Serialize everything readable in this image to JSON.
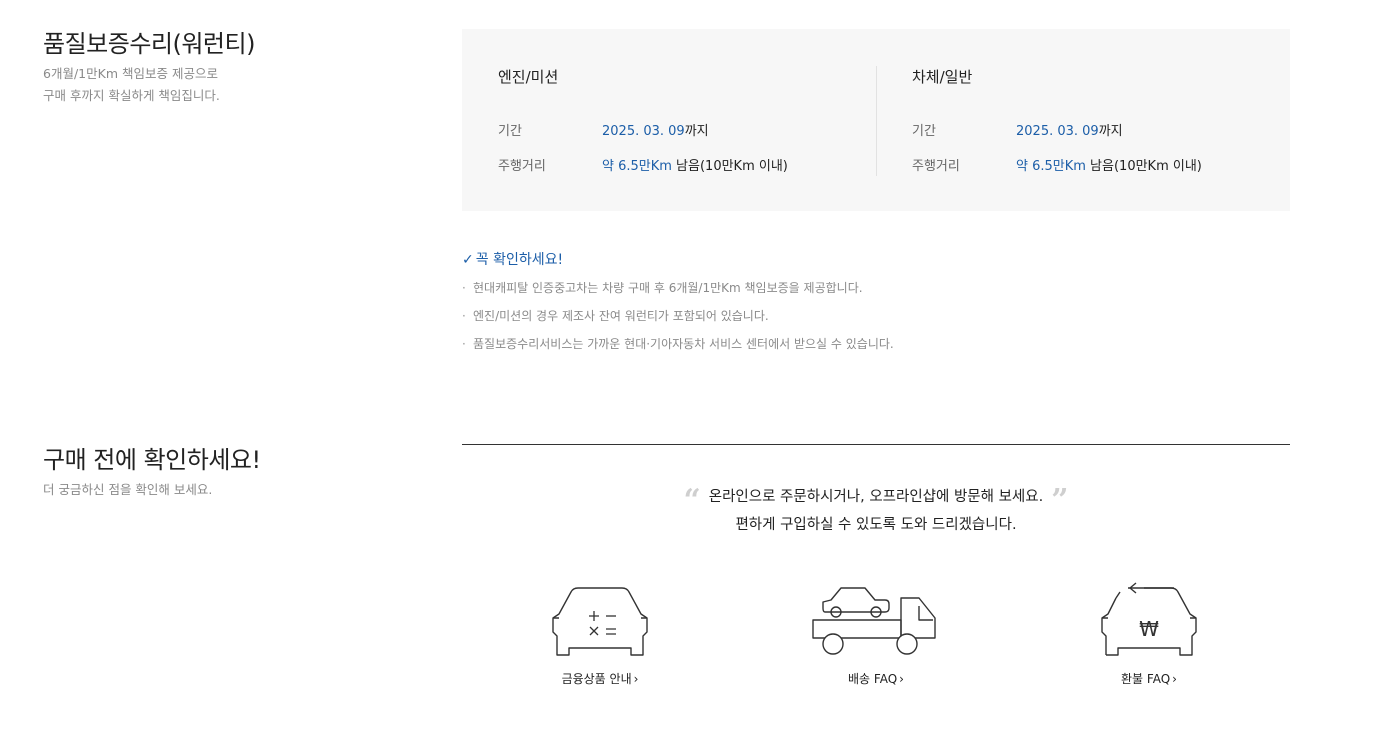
{
  "warranty": {
    "title": "품질보증수리(워런티)",
    "desc_line1": "6개월/1만Km 책임보증 제공으로",
    "desc_line2": "구매 후까지 확실하게 책임집니다.",
    "columns": [
      {
        "title": "엔진/미션",
        "period_label": "기간",
        "period_value": "2025. 03. 09",
        "period_suffix": "까지",
        "distance_label": "주행거리",
        "distance_value": "약 6.5만Km",
        "distance_suffix": " 남음(10만Km 이내)"
      },
      {
        "title": "차체/일반",
        "period_label": "기간",
        "period_value": "2025. 03. 09",
        "period_suffix": "까지",
        "distance_label": "주행거리",
        "distance_value": "약 6.5만Km",
        "distance_suffix": " 남음(10만Km 이내)"
      }
    ]
  },
  "check": {
    "title": "꼭 확인하세요!",
    "items": [
      "현대캐피탈 인증중고차는 차량 구매 후 6개월/1만Km 책임보증을 제공합니다.",
      "엔진/미션의 경우 제조사 잔여 워런티가 포함되어 있습니다.",
      "품질보증수리서비스는 가까운 현대·기아자동차 서비스 센터에서 받으실 수 있습니다."
    ]
  },
  "before_purchase": {
    "title": "구매 전에 확인하세요!",
    "desc": "더 궁금하신 점을 확인해 보세요.",
    "quote_line1": "온라인으로 주문하시거나, 오프라인샵에 방문해 보세요.",
    "quote_line2": "편하게 구입하실 수 있도록 도와 드리겠습니다.",
    "links": [
      {
        "label": "금융상품 안내",
        "icon": "car-calculator-icon"
      },
      {
        "label": "배송 FAQ",
        "icon": "tow-truck-icon"
      },
      {
        "label": "환불 FAQ",
        "icon": "car-refund-icon"
      }
    ]
  },
  "colors": {
    "accent": "#1c5ea8",
    "muted": "#8a8a8a",
    "box_bg": "#f7f7f7"
  }
}
